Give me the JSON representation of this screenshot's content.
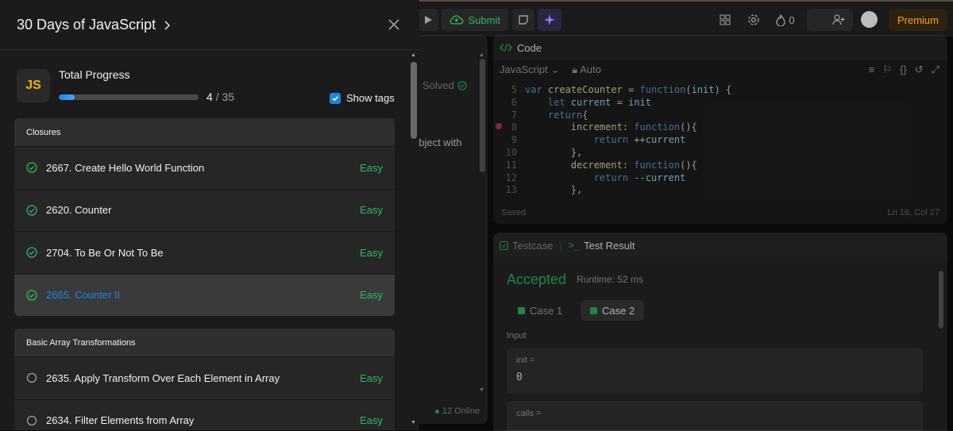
{
  "toolbar": {
    "submit_label": "Submit",
    "streak_count": "0",
    "premium_label": "Premium"
  },
  "problem_panel": {
    "solved_label": "Solved",
    "desc_fragment": "object with",
    "online_label": "12 Online"
  },
  "code_panel": {
    "tab_label": "Code",
    "language": "JavaScript",
    "mode": "Auto",
    "saved_label": "Saved",
    "cursor_pos": "Ln 16, Col 27",
    "lines": [
      {
        "n": "5",
        "code": "var createCounter = function(init) {"
      },
      {
        "n": "6",
        "code": "    let current = init"
      },
      {
        "n": "7",
        "code": "    return{"
      },
      {
        "n": "8",
        "code": "        increment: function(){"
      },
      {
        "n": "9",
        "code": "            return ++current"
      },
      {
        "n": "10",
        "code": "        },"
      },
      {
        "n": "11",
        "code": "        decrement: function(){"
      },
      {
        "n": "12",
        "code": "            return --current"
      },
      {
        "n": "13",
        "code": "        },"
      }
    ]
  },
  "test_panel": {
    "testcase_tab": "Testcase",
    "result_tab": "Test Result",
    "status": "Accepted",
    "runtime": "Runtime: 52 ms",
    "case1": "Case 1",
    "case2": "Case 2",
    "input_label": "Input",
    "input1_key": "init =",
    "input1_val": "0",
    "input2_key": "calls ="
  },
  "drawer": {
    "title": "30 Days of JavaScript",
    "progress_label": "Total Progress",
    "progress_done": "4",
    "progress_total": "/ 35",
    "progress_fraction": 0.114,
    "show_tags_label": "Show tags",
    "logo_text": "JS",
    "groups": [
      {
        "name": "Closures",
        "items": [
          {
            "title": "2667. Create Hello World Function",
            "difficulty": "Easy",
            "solved": true
          },
          {
            "title": "2620. Counter",
            "difficulty": "Easy",
            "solved": true
          },
          {
            "title": "2704. To Be Or Not To Be",
            "difficulty": "Easy",
            "solved": true
          },
          {
            "title": "2665. Counter II",
            "difficulty": "Easy",
            "solved": true,
            "active": true
          }
        ]
      },
      {
        "name": "Basic Array Transformations",
        "items": [
          {
            "title": "2635. Apply Transform Over Each Element in Array",
            "difficulty": "Easy",
            "solved": false
          },
          {
            "title": "2634. Filter Elements from Array",
            "difficulty": "Easy",
            "solved": false
          }
        ]
      }
    ]
  },
  "colors": {
    "accent_blue": "#1a86e6",
    "easy_green": "#2cbb5d",
    "premium_orange": "#ffa116"
  }
}
